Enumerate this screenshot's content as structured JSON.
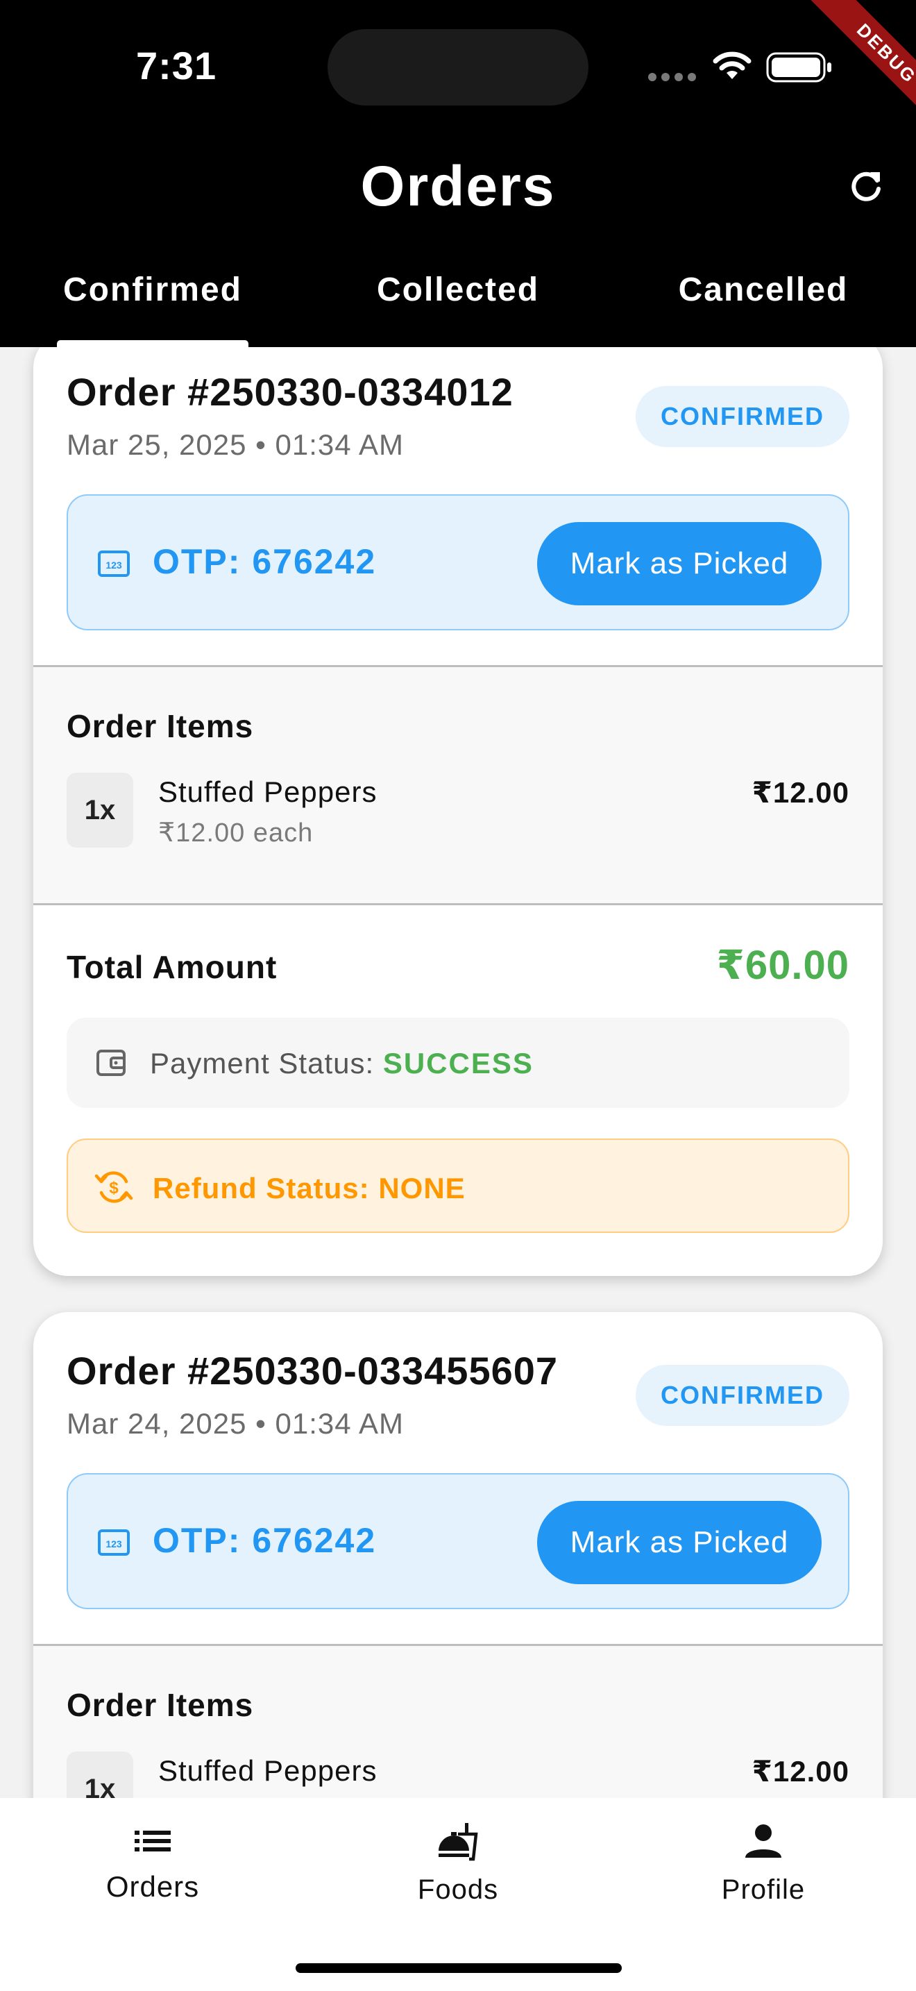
{
  "status_bar": {
    "time": "7:31"
  },
  "debug_label": "DEBUG",
  "header": {
    "title": "Orders"
  },
  "tabs": [
    {
      "label": "Confirmed",
      "active": true
    },
    {
      "label": "Collected",
      "active": false
    },
    {
      "label": "Cancelled",
      "active": false
    }
  ],
  "orders": [
    {
      "title": "Order #250330-0334012",
      "date": "Mar 25, 2025 • 01:34 AM",
      "status": "CONFIRMED",
      "otp": "OTP: 676242",
      "action_label": "Mark as Picked",
      "items_heading": "Order Items",
      "items": [
        {
          "qty": "1x",
          "name": "Stuffed Peppers",
          "each": "₹12.00 each",
          "price": "₹12.00"
        }
      ],
      "total_label": "Total Amount",
      "total_value": "₹60.00",
      "payment_label": "Payment Status:",
      "payment_value": "SUCCESS",
      "refund_label": "Refund Status: NONE"
    },
    {
      "title": "Order #250330-033455607",
      "date": "Mar 24, 2025 • 01:34 AM",
      "status": "CONFIRMED",
      "otp": "OTP: 676242",
      "action_label": "Mark as Picked",
      "items_heading": "Order Items",
      "items": [
        {
          "qty": "1x",
          "name": "Stuffed Peppers",
          "price": "₹12.00"
        }
      ]
    }
  ],
  "bottom_nav": [
    {
      "label": "Orders",
      "icon": "list-icon"
    },
    {
      "label": "Foods",
      "icon": "food-icon"
    },
    {
      "label": "Profile",
      "icon": "person-icon"
    }
  ],
  "colors": {
    "accent": "#2196f3",
    "success": "#4caf50",
    "warning": "#ff9800",
    "header_bg": "#000000"
  }
}
